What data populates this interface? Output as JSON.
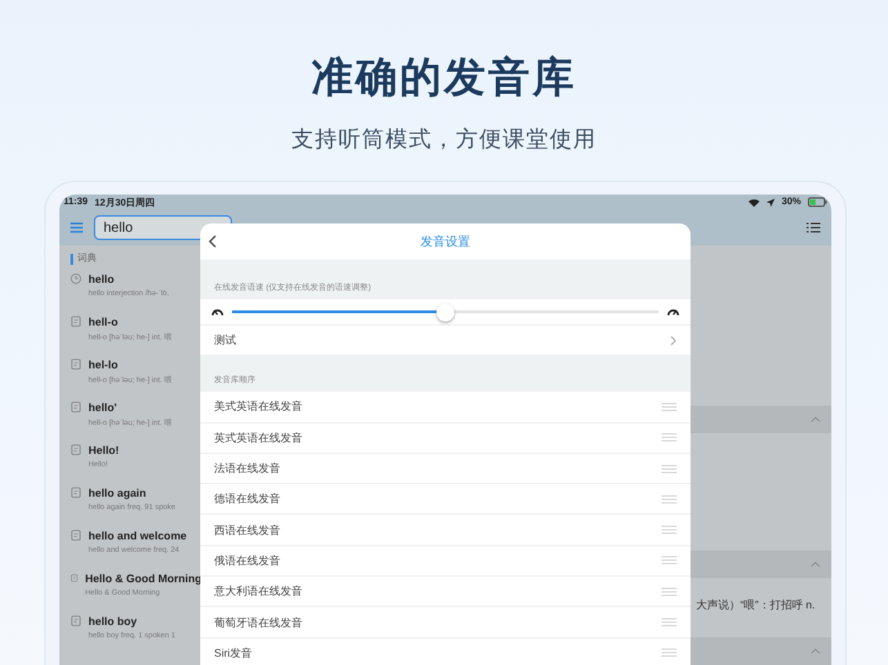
{
  "hero": {
    "title": "准确的发音库",
    "subtitle": "支持听筒模式，方便课堂使用"
  },
  "status_bar": {
    "time": "11:39",
    "date": "12月30日周四",
    "battery": "30%"
  },
  "search": {
    "value": "hello"
  },
  "sidebar": {
    "section": "词典",
    "items": [
      {
        "kind": "history",
        "word": "hello",
        "detail": "hello  interjection  /hə-ˈlō,"
      },
      {
        "kind": "word",
        "word": "hell-o",
        "detail": "hell-o [həˈləʊ; he-]  int. 喂"
      },
      {
        "kind": "word",
        "word": "hel-lo",
        "detail": "hell-o [həˈləʊ; he-]  int. 喂"
      },
      {
        "kind": "word",
        "word": "hello'",
        "detail": "hell-o [həˈləʊ; he-]  int. 喂"
      },
      {
        "kind": "word",
        "word": "Hello!",
        "detail": "Hello!"
      },
      {
        "kind": "word",
        "word": "hello again",
        "detail": "hello again  freq. 91  spoke"
      },
      {
        "kind": "word",
        "word": "hello and welcome",
        "detail": "hello and welcome  freq. 24"
      },
      {
        "kind": "word",
        "word": "Hello & Good Morning",
        "detail": "Hello & Good Morning"
      },
      {
        "kind": "word",
        "word": "hello boy",
        "detail": "hello boy  freq. 1  spoken 1"
      }
    ]
  },
  "detail_pane": {
    "definition": "大声说）“喂”：打招呼 n."
  },
  "dialog": {
    "title": "发音设置",
    "speed_section": "在线发音语速 (仅支持在线发音的语速调整)",
    "speed": {
      "level": 0.5
    },
    "test_label": "测试",
    "order_section": "发音库顺序",
    "sources": [
      "美式英语在线发音",
      "英式英语在线发音",
      "法语在线发音",
      "德语在线发音",
      "西语在线发音",
      "俄语在线发音",
      "意大利语在线发音",
      "葡萄牙语在线发音",
      "Siri发音"
    ]
  }
}
